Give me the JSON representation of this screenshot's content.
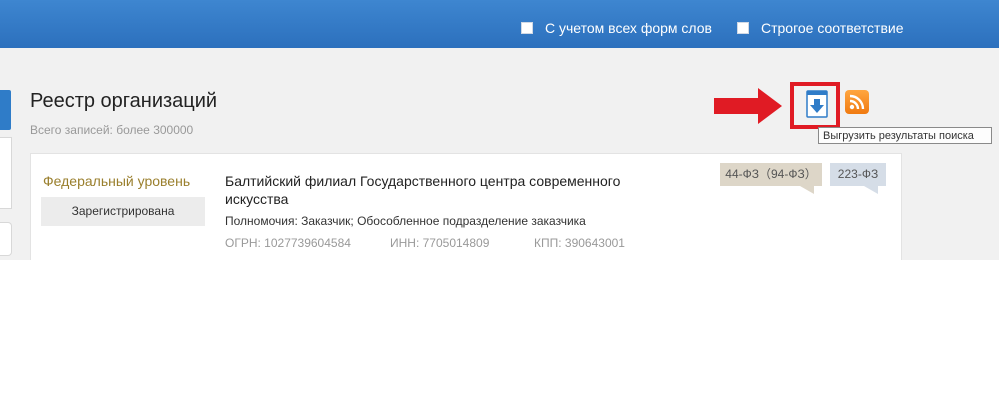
{
  "header": {
    "options": [
      {
        "label": "С учетом всех форм слов",
        "checked": false
      },
      {
        "label": "Строгое соответствие",
        "checked": false
      }
    ]
  },
  "page": {
    "title": "Реестр организаций",
    "total": "Всего записей: более 300000"
  },
  "toolbar": {
    "download_icon": "download-document-icon",
    "rss_icon": "rss-icon",
    "tooltip": "Выгрузить результаты поиска",
    "annotation_color": "#e01b24"
  },
  "result": {
    "level": "Федеральный уровень",
    "status": "Зарегистрирована",
    "name": "Балтийский филиал Государственного центра современного искусства",
    "powers": "Полномочия: Заказчик; Обособленное подразделение заказчика",
    "ogrn": "ОГРН: 1027739604584",
    "inn": "ИНН: 7705014809",
    "kpp": "КПП: 390643001",
    "badges": [
      "44-ФЗ（94-ФЗ）",
      "223-ФЗ"
    ]
  }
}
